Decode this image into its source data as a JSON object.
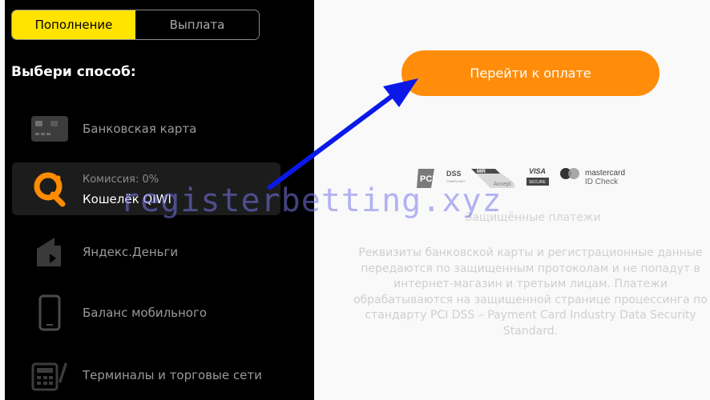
{
  "tabs": {
    "deposit": "Пополнение",
    "withdraw": "Выплата"
  },
  "choose_method_label": "Выбери способ:",
  "methods": [
    {
      "icon": "bank-card-icon",
      "label": "Банковская карта"
    },
    {
      "icon": "qiwi-icon",
      "commission": "Комиссия: 0%",
      "label": "Кошелёк QIWI",
      "selected": true
    },
    {
      "icon": "yandex-money-icon",
      "label": "Яндекс.Деньги"
    },
    {
      "icon": "mobile-phone-icon",
      "label": "Баланс мобильного"
    },
    {
      "icon": "terminal-icon",
      "label": "Терминалы и торговые сети"
    }
  ],
  "pay_button": "Перейти к оплате",
  "security_logos": {
    "pci": "PCI",
    "pci_dss": "DSS",
    "pci_compliant": "COMPLIANT",
    "mir": "MIR",
    "mir_accept": "Accept",
    "visa": "VISA",
    "visa_secure": "SECURE",
    "mastercard": "mastercard",
    "mastercard_check": "ID Check"
  },
  "secure_text": "Защищённые платежи",
  "info_text": [
    "Реквизиты банковской карты и регистрационные данные",
    "передаются по защищенным протоколам и не попадут в",
    "интернет-магазин и третьим лицам. Платежи",
    "обрабатываются на защищенной странице процессинга по",
    "стандарту PCI DSS – Payment Card Industry Data Security",
    "Standard."
  ],
  "watermark": "registerbetting.xyz",
  "colors": {
    "accent_yellow": "#ffe400",
    "pay_orange": "#ff8d0a",
    "qiwi_orange": "#ff8c00",
    "arrow_blue": "#0a19e8"
  }
}
